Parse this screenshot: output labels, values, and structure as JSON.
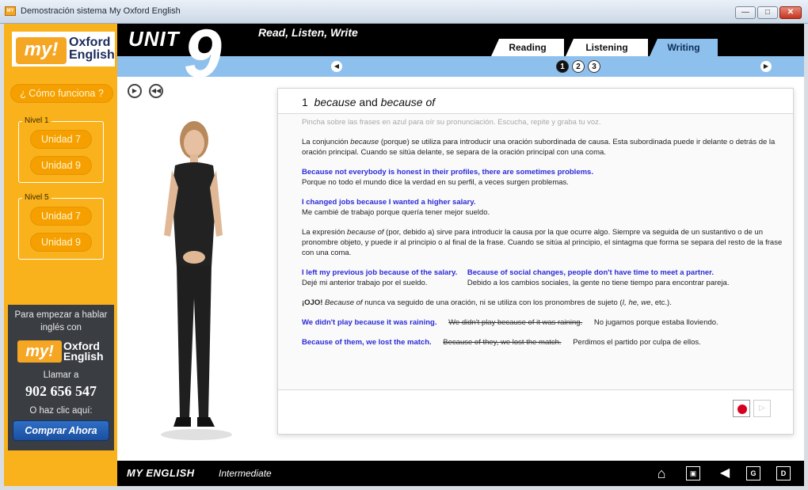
{
  "window": {
    "title": "Demostración sistema My Oxford English",
    "app_icon_text": "MY",
    "controls": {
      "minimize": "—",
      "maximize": "□",
      "close": "✕"
    }
  },
  "sidebar": {
    "logo": {
      "my": "my!",
      "oxford": "Oxford",
      "english": "English"
    },
    "como_funciona": "¿ Cómo funciona ?",
    "niveles": [
      {
        "label": "Nivel 1",
        "units": [
          "Unidad 7",
          "Unidad 9"
        ]
      },
      {
        "label": "Nivel 5",
        "units": [
          "Unidad 7",
          "Unidad 9"
        ]
      }
    ],
    "promo": {
      "line1": "Para empezar a hablar",
      "line2": "inglés con",
      "logo_my": "my!",
      "logo_oxford": "Oxford",
      "logo_english": "English",
      "call": "Llamar a",
      "phone": "902 656 547",
      "or_click": "O haz clic aquí:",
      "buy_button": "Comprar Ahora"
    }
  },
  "header": {
    "unit_label": "UNIT",
    "unit_number": "9",
    "section_title": "Read, Listen, Write",
    "tabs": [
      {
        "label": "Reading",
        "active": false
      },
      {
        "label": "Listening",
        "active": false
      },
      {
        "label": "Writing",
        "active": true
      }
    ],
    "pages": [
      "1",
      "2",
      "3"
    ],
    "active_page": "1"
  },
  "lesson": {
    "number": "1",
    "title_part1": "because",
    "title_and": " and ",
    "title_part2": "because of",
    "instruction": "Pincha sobre las frases en azul para oír su pronunciación. Escucha, repite y graba tu voz.",
    "para1_a": "La conjunción ",
    "para1_em": "because",
    "para1_b": " (porque) se utiliza para introducir una oración subordinada de causa. Esta subordinada puede ir delante o detrás de la oración principal. Cuando se sitúa delante, se separa de la oración principal con una coma.",
    "ex1_en": "Because not everybody is honest in their profiles, there are sometimes problems.",
    "ex1_es": "Porque no todo el mundo dice la verdad en su perfil, a veces surgen problemas.",
    "ex2_en": "I changed jobs because I wanted a higher salary.",
    "ex2_es": "Me cambié de trabajo porque quería tener mejor sueldo.",
    "para2_a": "La expresión ",
    "para2_em": "because of",
    "para2_b": " (por, debido a) sirve para introducir la causa por la que ocurre algo. Siempre va seguida de un sustantivo o de un pronombre objeto, y puede ir al principio o al final de la frase. Cuando se sitúa al principio, el sintagma que forma se separa del resto de la frase con una coma.",
    "ex3_en": "I left my previous job because of the salary.",
    "ex3_es": "Dejé mi anterior trabajo por el sueldo.",
    "ex4_en": "Because of social changes, people don't have time to meet a partner.",
    "ex4_es": "Debido a los cambios sociales, la gente no tiene tiempo para encontrar pareja.",
    "ojo_label": "¡OJO!",
    "ojo_em": "Because of",
    "ojo_text": " nunca va seguido de una oración, ni se utiliza con los pronombres de sujeto (",
    "ojo_pron": "I, he, we",
    "ojo_end": ", etc.).",
    "ex5_en": "We didn't play because it was raining.",
    "ex5_wrong": "We didn't play because of it was raining.",
    "ex5_es": "No jugamos porque estaba lloviendo.",
    "ex6_en": "Because of them, we lost the match.",
    "ex6_wrong": "Because of they, we lost the match.",
    "ex6_es": "Perdimos el partido por culpa de ellos."
  },
  "controls": {
    "play": "▶",
    "rewind": "◀◀",
    "record": "",
    "play_recording": "▷"
  },
  "footer": {
    "brand": "MY ENGLISH",
    "level": "Intermediate",
    "buttons": {
      "home": "⌂",
      "save": "▣",
      "sound": "◀",
      "grammar": "G",
      "dictionary": "D"
    }
  }
}
